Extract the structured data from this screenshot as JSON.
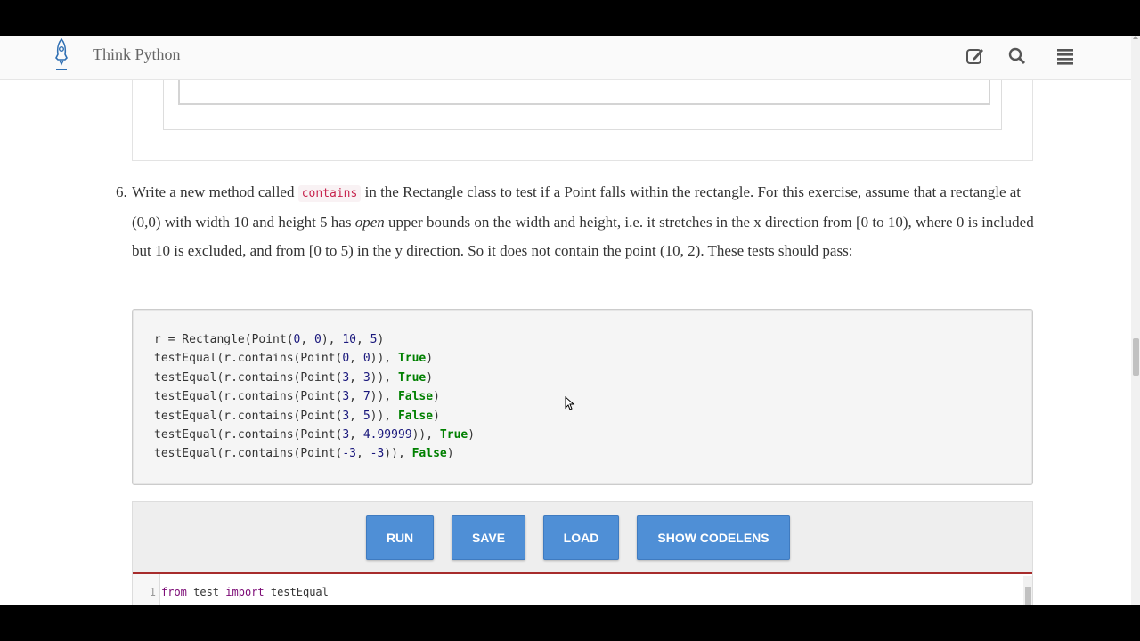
{
  "navbar": {
    "title": "Think Python",
    "icons": [
      "edit-icon",
      "search-icon",
      "menu-icon"
    ]
  },
  "exercise": {
    "number": "6.",
    "text_before_code": "Write a new method called ",
    "code_term": "contains",
    "text_middle": " in the Rectangle class to test if a Point falls within the rectangle. For this exercise, assume that a rectangle at (0,0) with width 10 and height 5 has ",
    "emphasis": "open",
    "text_after": " upper bounds on the width and height, i.e. it stretches in the x direction from [0 to 10), where 0 is included but 10 is excluded, and from [0 to 5) in the y direction. So it does not contain the point (10, 2). These tests should pass:"
  },
  "code_block": {
    "lines": [
      "r = Rectangle(Point(0, 0), 10, 5)",
      "testEqual(r.contains(Point(0, 0)), True)",
      "testEqual(r.contains(Point(3, 3)), True)",
      "testEqual(r.contains(Point(3, 7)), False)",
      "testEqual(r.contains(Point(3, 5)), False)",
      "testEqual(r.contains(Point(3, 4.99999)), True)",
      "testEqual(r.contains(Point(-3, -3)), False)"
    ]
  },
  "activecode": {
    "buttons": {
      "run": "RUN",
      "save": "SAVE",
      "load": "LOAD",
      "codelens": "SHOW CODELENS"
    },
    "editor": {
      "line_number": "1",
      "line_code": "from test import testEqual"
    }
  },
  "colors": {
    "accent": "#4f8fd6",
    "editor_border": "#a72c2c",
    "logo": "#3a7bd5"
  }
}
